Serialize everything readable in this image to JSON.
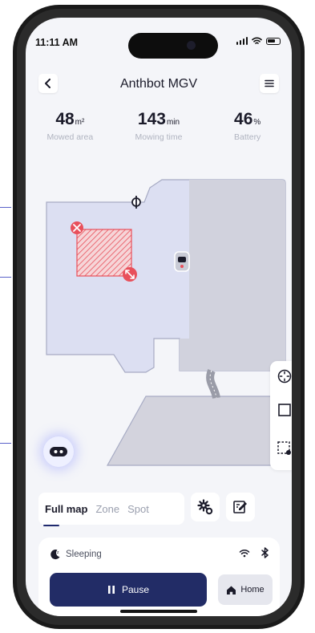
{
  "status_bar": {
    "time": "11:11 AM"
  },
  "nav": {
    "title": "Anthbot MGV"
  },
  "stats": [
    {
      "value": "48",
      "unit": "m²",
      "label": "Mowed area"
    },
    {
      "value": "143",
      "unit": "min",
      "label": "Mowing time"
    },
    {
      "value": "46",
      "unit": "%",
      "label": "Battery"
    }
  ],
  "tabs": [
    {
      "label": "Full map",
      "active": true
    },
    {
      "label": "Zone",
      "active": false
    },
    {
      "label": "Spot",
      "active": false
    }
  ],
  "panel": {
    "status": "Sleeping",
    "pause_label": "Pause",
    "home_label": "Home"
  },
  "colors": {
    "accent": "#222c66",
    "lawn_main": "#dcdff2",
    "lawn_shaded": "#d3d3dd",
    "no_go_zone": "#e8505b"
  },
  "icons": [
    "back-icon",
    "menu-icon",
    "locate-icon",
    "square-icon",
    "area-select-icon",
    "robot-icon",
    "settings-icon",
    "edit-map-icon",
    "moon-icon",
    "wifi-icon",
    "bluetooth-icon",
    "pause-icon",
    "home-icon"
  ]
}
